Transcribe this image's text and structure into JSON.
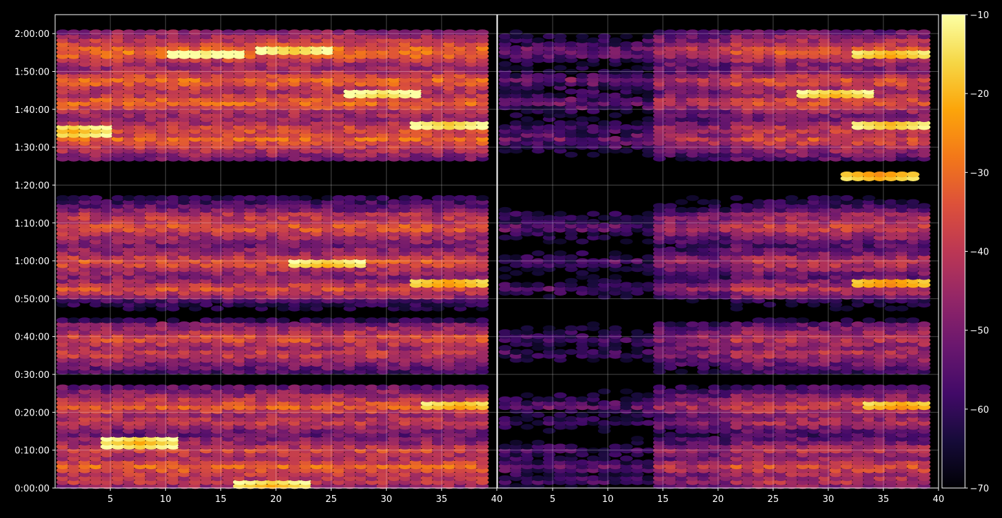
{
  "chart_data": {
    "type": "heatmap",
    "title": "",
    "xlabel": "",
    "ylabel": "",
    "background": "#000000",
    "grid": true,
    "colormap": "inferno",
    "colorbar": {
      "position": "right",
      "min": -70,
      "max": -10,
      "ticks": [
        -10,
        -20,
        -30,
        -40,
        -50,
        -60,
        -70
      ],
      "tick_labels": [
        "−10",
        "−20",
        "−30",
        "−40",
        "−50",
        "−60",
        "−70"
      ]
    },
    "y_axis": {
      "unit": "time",
      "range_seconds": [
        0,
        7500
      ],
      "tick_values_seconds": [
        0,
        600,
        1200,
        1800,
        2400,
        3000,
        3600,
        4200,
        4800,
        5400,
        6000,
        6600,
        7200
      ],
      "tick_labels": [
        "0:00:00",
        "0:10:00",
        "0:20:00",
        "0:30:00",
        "0:40:00",
        "0:50:00",
        "1:00:00",
        "1:10:00",
        "1:20:00",
        "1:30:00",
        "1:40:00",
        "1:50:00",
        "2:00:00"
      ]
    },
    "panels": [
      {
        "name": "left",
        "x_range": [
          1,
          40
        ],
        "x_ticks": [
          5,
          10,
          15,
          20,
          25,
          30,
          35,
          40
        ],
        "x_tick_labels": [
          "5",
          "10",
          "15",
          "20",
          "25",
          "30",
          "35",
          "40"
        ],
        "cells_per_row": 39,
        "rows_approx": 120,
        "band_profile_note": "dense over full time range; values mostly -55 to -30 dB, peaks near -15 dB",
        "bands": [
          {
            "t_center": 120,
            "level": -38
          },
          {
            "t_center": 330,
            "level": -30
          },
          {
            "t_center": 600,
            "level": -36
          },
          {
            "t_center": 1050,
            "level": -38
          },
          {
            "t_center": 1300,
            "level": -32
          },
          {
            "t_center": 2130,
            "level": -37
          },
          {
            "t_center": 2370,
            "level": -34
          },
          {
            "t_center": 3160,
            "level": -35
          },
          {
            "t_center": 3580,
            "level": -33
          },
          {
            "t_center": 4130,
            "level": -32
          },
          {
            "t_center": 4300,
            "level": -38
          },
          {
            "t_center": 5520,
            "level": -30
          },
          {
            "t_center": 5680,
            "level": -34
          },
          {
            "t_center": 6110,
            "level": -30
          },
          {
            "t_center": 6450,
            "level": -30
          },
          {
            "t_center": 6870,
            "level": -31
          },
          {
            "t_center": 6930,
            "level": -28
          }
        ],
        "hotspots": [
          {
            "x": 2,
            "t": 5650,
            "value": -22
          },
          {
            "x": 14,
            "t": 6880,
            "value": -15
          },
          {
            "x": 22,
            "t": 6940,
            "value": -20
          },
          {
            "x": 30,
            "t": 6230,
            "value": -18
          },
          {
            "x": 36,
            "t": 5760,
            "value": -20
          },
          {
            "x": 37,
            "t": 1290,
            "value": -24
          },
          {
            "x": 36,
            "t": 3240,
            "value": -26
          },
          {
            "x": 8,
            "t": 720,
            "value": -22
          },
          {
            "x": 20,
            "t": 30,
            "value": -22
          },
          {
            "x": 25,
            "t": 3540,
            "value": -22
          }
        ]
      },
      {
        "name": "right",
        "x_range": [
          1,
          40
        ],
        "x_ticks": [
          5,
          10,
          15,
          20,
          25,
          30,
          35,
          40
        ],
        "x_tick_labels": [
          "5",
          "10",
          "15",
          "20",
          "25",
          "30",
          "35",
          "40"
        ],
        "cells_per_row": 39,
        "rows_approx": 120,
        "band_profile_note": "sparse for x < 15 (mostly empty), dense for x > 15; same time bands as left panel",
        "bands": [
          {
            "t_center": 120,
            "level": -40
          },
          {
            "t_center": 330,
            "level": -34
          },
          {
            "t_center": 600,
            "level": -40
          },
          {
            "t_center": 1050,
            "level": -42
          },
          {
            "t_center": 1300,
            "level": -36
          },
          {
            "t_center": 2130,
            "level": -40
          },
          {
            "t_center": 2370,
            "level": -38
          },
          {
            "t_center": 3160,
            "level": -40
          },
          {
            "t_center": 3580,
            "level": -38
          },
          {
            "t_center": 4130,
            "level": -36
          },
          {
            "t_center": 4300,
            "level": -42
          },
          {
            "t_center": 5520,
            "level": -34
          },
          {
            "t_center": 5680,
            "level": -38
          },
          {
            "t_center": 6110,
            "level": -34
          },
          {
            "t_center": 6450,
            "level": -34
          },
          {
            "t_center": 6870,
            "level": -36
          },
          {
            "t_center": 6930,
            "level": -32
          }
        ],
        "hotspots": [
          {
            "x": 36,
            "t": 5760,
            "value": -22
          },
          {
            "x": 36,
            "t": 6860,
            "value": -24
          },
          {
            "x": 31,
            "t": 6230,
            "value": -22
          },
          {
            "x": 37,
            "t": 1290,
            "value": -26
          },
          {
            "x": 36,
            "t": 3240,
            "value": -28
          },
          {
            "x": 35,
            "t": 4960,
            "value": -26
          }
        ]
      }
    ]
  }
}
